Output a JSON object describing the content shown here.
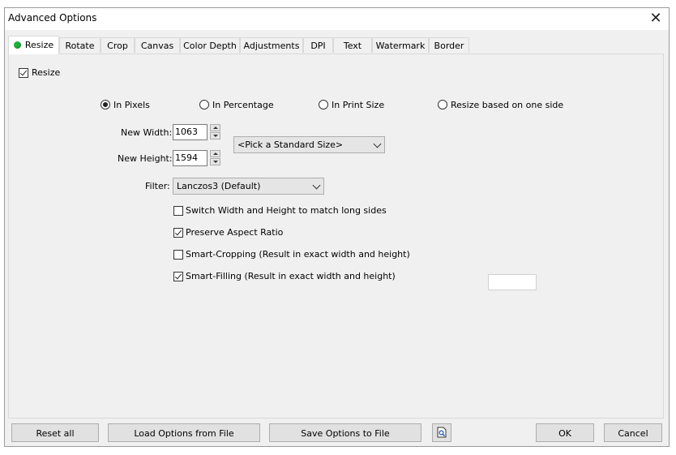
{
  "window": {
    "title": "Advanced Options"
  },
  "tabs": [
    {
      "label": "Resize",
      "active": true
    },
    {
      "label": "Rotate"
    },
    {
      "label": "Crop"
    },
    {
      "label": "Canvas"
    },
    {
      "label": "Color Depth"
    },
    {
      "label": "Adjustments"
    },
    {
      "label": "DPI"
    },
    {
      "label": "Text"
    },
    {
      "label": "Watermark"
    },
    {
      "label": "Border"
    }
  ],
  "resize": {
    "enable_label": "Resize",
    "enabled": true,
    "modes": [
      {
        "label": "In Pixels",
        "selected": true
      },
      {
        "label": "In Percentage",
        "selected": false
      },
      {
        "label": "In Print Size",
        "selected": false
      },
      {
        "label": "Resize based on one side",
        "selected": false
      }
    ],
    "width_label": "New Width:",
    "width_value": "1063",
    "height_label": "New Height:",
    "height_value": "1594",
    "standard_size": "<Pick a Standard Size>",
    "filter_label": "Filter:",
    "filter_value": "Lanczos3 (Default)",
    "options": [
      {
        "label": "Switch Width and Height to match long sides",
        "checked": false
      },
      {
        "label": "Preserve Aspect Ratio",
        "checked": true
      },
      {
        "label": "Smart-Cropping (Result in exact width and height)",
        "checked": false
      },
      {
        "label": "Smart-Filling (Result in exact width and height)",
        "checked": true
      }
    ],
    "fill_color": "#ffffff"
  },
  "buttons": {
    "reset": "Reset all",
    "load": "Load Options from File",
    "save": "Save Options to File",
    "ok": "OK",
    "cancel": "Cancel"
  },
  "colors": {
    "accent_dot": "#1fb23a"
  }
}
